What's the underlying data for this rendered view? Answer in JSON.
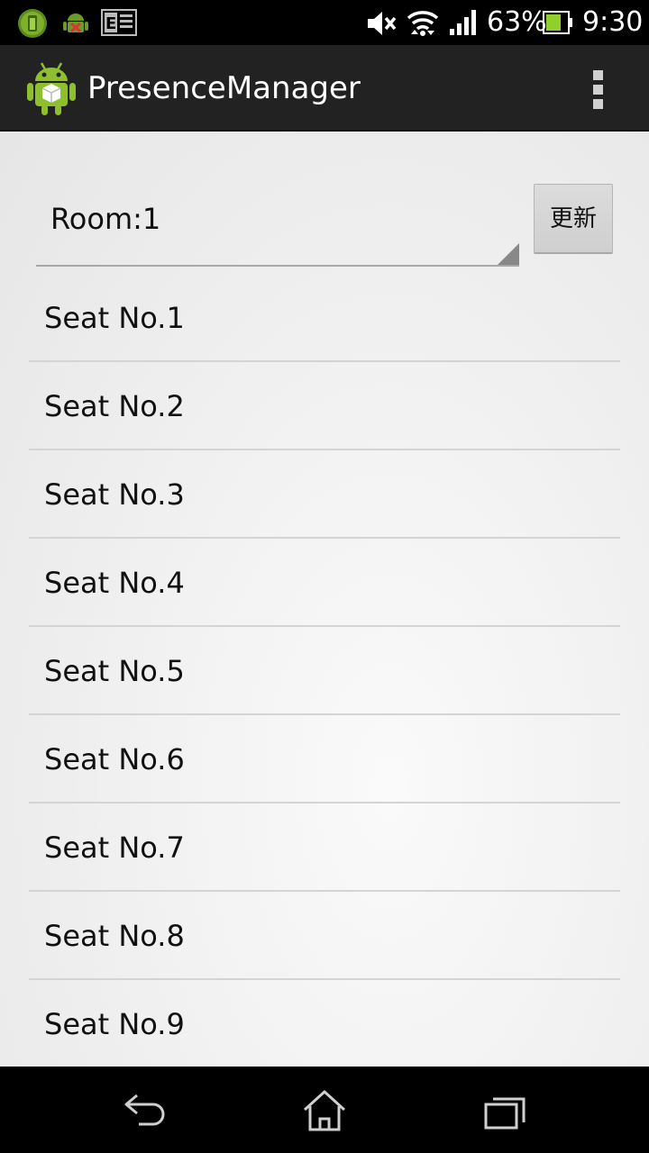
{
  "status_bar": {
    "battery_percent": "63%",
    "time": "9:30",
    "icons": [
      "battery-saver-icon",
      "android-debug-icon",
      "keyboard-input-icon",
      "mute-icon",
      "wifi-icon",
      "signal-icon",
      "battery-icon"
    ],
    "battery_level": 0.63
  },
  "action_bar": {
    "title": "PresenceManager",
    "icon": "app-android-icon",
    "overflow_icon": "overflow-menu-icon"
  },
  "room": {
    "selected": "Room:1"
  },
  "refresh_button": {
    "label": "更新"
  },
  "seats": [
    {
      "label": "Seat No.1"
    },
    {
      "label": "Seat No.2"
    },
    {
      "label": "Seat No.3"
    },
    {
      "label": "Seat No.4"
    },
    {
      "label": "Seat No.5"
    },
    {
      "label": "Seat No.6"
    },
    {
      "label": "Seat No.7"
    },
    {
      "label": "Seat No.8"
    },
    {
      "label": "Seat No.9"
    }
  ],
  "nav_bar": {
    "icons": [
      "back-icon",
      "home-icon",
      "recent-apps-icon"
    ]
  },
  "colors": {
    "action_bar": "#222222",
    "android_green": "#8ebf2f"
  }
}
